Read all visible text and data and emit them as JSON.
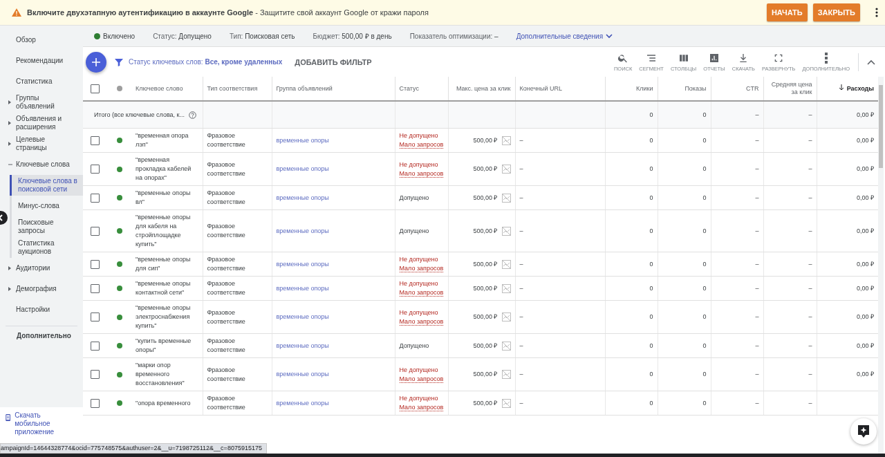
{
  "banner": {
    "title": "Включите двухэтапную аутентификацию в аккаунте Google",
    "text": " - Защитите свой аккаунт Google от кражи пароля",
    "buttons": [
      "НАЧАТЬ",
      "ЗАКРЫТЬ"
    ]
  },
  "sidebar": {
    "items": [
      {
        "label": "Обзор",
        "selected": false
      },
      {
        "label": "Рекомендации",
        "selected": false
      },
      {
        "label": "Статистика",
        "selected": false
      },
      {
        "label": "Группы объявлений",
        "selected": false,
        "expanded": false
      },
      {
        "label": "Объявления и расширения",
        "selected": false,
        "expanded": false
      },
      {
        "label": "Целевые страницы",
        "selected": false,
        "expanded": false
      },
      {
        "label": "Ключевые слова",
        "selected": false,
        "expanded": true,
        "children": [
          {
            "label": "Ключевые слова в поисковой сети",
            "selected": true
          },
          {
            "label": "Минус-слова",
            "selected": false
          },
          {
            "label": "Поисковые запросы",
            "selected": false
          },
          {
            "label": "Статистика аукционов",
            "selected": false
          }
        ]
      },
      {
        "label": "Аудитории",
        "selected": false,
        "expanded": false
      },
      {
        "label": "Демография",
        "selected": false,
        "expanded": false
      },
      {
        "label": "Настройки",
        "selected": false
      }
    ],
    "more": "Дополнительно",
    "app_link": "Скачать мобильное приложение"
  },
  "summary": {
    "state": "Включено",
    "items": [
      {
        "label": "Статус:",
        "value": "Допущено"
      },
      {
        "label": "Тип:",
        "value": "Поисковая сеть"
      },
      {
        "label": "Бюджет:",
        "value": "500,00 ₽ в день"
      },
      {
        "label": "Показатель оптимизации:",
        "value": "–"
      }
    ],
    "details_link": "Дополнительные сведения"
  },
  "toolbar": {
    "filter_label": "Статус ключевых слов:",
    "filter_value": "Все, кроме удаленных",
    "add_filter": "ДОБАВИТЬ ФИЛЬТР",
    "tools": [
      {
        "kind": "search",
        "label": "ПОИСК"
      },
      {
        "kind": "segment",
        "label": "СЕГМЕНТ"
      },
      {
        "kind": "columns",
        "label": "СТОЛБЦЫ"
      },
      {
        "kind": "reports",
        "label": "ОТЧЕТЫ"
      },
      {
        "kind": "download",
        "label": "СКАЧАТЬ"
      },
      {
        "kind": "expand",
        "label": "РАЗВЕРНУТЬ"
      },
      {
        "kind": "more",
        "label": "ДОПОЛНИТЕЛЬНО"
      }
    ]
  },
  "table": {
    "select_all_checked": false,
    "columns": [
      "Ключевое слово",
      "Тип соответствия",
      "Группа объявлений",
      "Статус",
      "Макс. цена за клик",
      "Конечный URL",
      "Клики",
      "Показы",
      "CTR",
      "Средняя цена за клик",
      "Расходы"
    ],
    "total": {
      "label": "Итого (все ключевые слова, к...",
      "clicks": "0",
      "impressions": "0",
      "ctr": "–",
      "avg_cpc": "–",
      "cost": "0,00 ₽"
    },
    "rows": [
      {
        "checked": false,
        "keyword": "\"временная опора лэп\"",
        "match": "Фразовое соответствие",
        "group": "временные опоры",
        "status": {
          "kind": "disapproved",
          "text": "Не допущено",
          "reason": "Мало запросов"
        },
        "bid": "500,00 ₽",
        "url": "–",
        "clicks": "0",
        "impressions": "0",
        "ctr": "–",
        "avg_cpc": "–",
        "cost": "0,00 ₽"
      },
      {
        "checked": false,
        "keyword": "\"временная прокладка кабелей на опорах\"",
        "match": "Фразовое соответствие",
        "group": "временные опоры",
        "status": {
          "kind": "disapproved",
          "text": "Не допущено",
          "reason": "Мало запросов"
        },
        "bid": "500,00 ₽",
        "url": "–",
        "clicks": "0",
        "impressions": "0",
        "ctr": "–",
        "avg_cpc": "–",
        "cost": "0,00 ₽"
      },
      {
        "checked": false,
        "keyword": "\"временные опоры вл\"",
        "match": "Фразовое соответствие",
        "group": "временные опоры",
        "status": {
          "kind": "eligible",
          "text": "Допущено"
        },
        "bid": "500,00 ₽",
        "url": "–",
        "clicks": "0",
        "impressions": "0",
        "ctr": "–",
        "avg_cpc": "–",
        "cost": "0,00 ₽"
      },
      {
        "checked": false,
        "keyword": "\"временные опоры для кабеля на стройплощадке купить\"",
        "match": "Фразовое соответствие",
        "group": "временные опоры",
        "status": {
          "kind": "eligible",
          "text": "Допущено"
        },
        "bid": "500,00 ₽",
        "url": "–",
        "clicks": "0",
        "impressions": "0",
        "ctr": "–",
        "avg_cpc": "–",
        "cost": "0,00 ₽"
      },
      {
        "checked": false,
        "keyword": "\"временные опоры для сип\"",
        "match": "Фразовое соответствие",
        "group": "временные опоры",
        "status": {
          "kind": "disapproved",
          "text": "Не допущено",
          "reason": "Мало запросов"
        },
        "bid": "500,00 ₽",
        "url": "–",
        "clicks": "0",
        "impressions": "0",
        "ctr": "–",
        "avg_cpc": "–",
        "cost": "0,00 ₽"
      },
      {
        "checked": false,
        "keyword": "\"временные опоры контактной сети\"",
        "match": "Фразовое соответствие",
        "group": "временные опоры",
        "status": {
          "kind": "disapproved",
          "text": "Не допущено",
          "reason": "Мало запросов"
        },
        "bid": "500,00 ₽",
        "url": "–",
        "clicks": "0",
        "impressions": "0",
        "ctr": "–",
        "avg_cpc": "–",
        "cost": "0,00 ₽"
      },
      {
        "checked": false,
        "keyword": "\"временные опоры электроснабжения купить\"",
        "match": "Фразовое соответствие",
        "group": "временные опоры",
        "status": {
          "kind": "disapproved",
          "text": "Не допущено",
          "reason": "Мало запросов"
        },
        "bid": "500,00 ₽",
        "url": "–",
        "clicks": "0",
        "impressions": "0",
        "ctr": "–",
        "avg_cpc": "–",
        "cost": "0,00 ₽"
      },
      {
        "checked": false,
        "keyword": "\"купить временные опоры\"",
        "match": "Фразовое соответствие",
        "group": "временные опоры",
        "status": {
          "kind": "eligible",
          "text": "Допущено"
        },
        "bid": "500,00 ₽",
        "url": "–",
        "clicks": "0",
        "impressions": "0",
        "ctr": "–",
        "avg_cpc": "–",
        "cost": "0,00 ₽"
      },
      {
        "checked": false,
        "keyword": "\"марки опор временного восстановления\"",
        "match": "Фразовое соответствие",
        "group": "временные опоры",
        "status": {
          "kind": "disapproved",
          "text": "Не допущено",
          "reason": "Мало запросов"
        },
        "bid": "500,00 ₽",
        "url": "–",
        "clicks": "0",
        "impressions": "0",
        "ctr": "–",
        "avg_cpc": "–",
        "cost": "0,00 ₽"
      },
      {
        "checked": false,
        "keyword": "\"опора временного",
        "match": "Фразовое соответствие",
        "group": "временные опоры",
        "status": {
          "kind": "disapproved",
          "text": "Не допущено",
          "reason": "Мало запросов"
        },
        "bid": "500,00 ₽",
        "url": "–",
        "clicks": "0",
        "impressions": "0",
        "ctr": "–",
        "avg_cpc": "–"
      }
    ]
  },
  "status_bar": "ampaignId=14644328774&ocid=775748575&authuser=2&__u=7198725112&__c=8075915175"
}
